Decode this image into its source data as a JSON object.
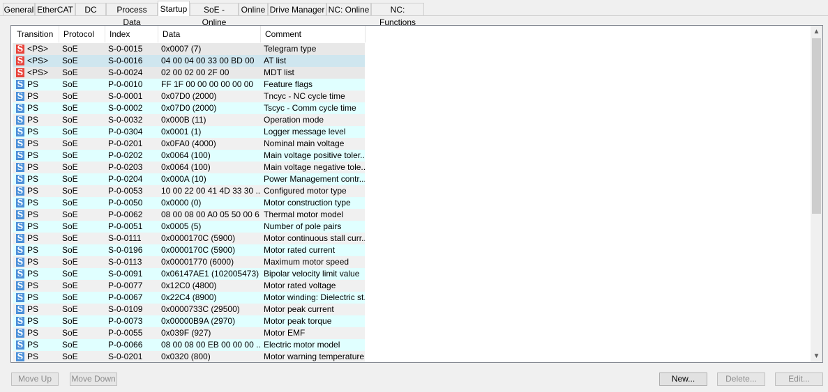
{
  "tabs": [
    "General",
    "EtherCAT",
    "DC",
    "Process Data",
    "Startup",
    "SoE - Online",
    "Online",
    "Drive Manager",
    "NC: Online",
    "NC: Functions"
  ],
  "active_tab": "Startup",
  "columns": [
    "Transition",
    "Protocol",
    "Index",
    "Data",
    "Comment"
  ],
  "icon_letter": "S",
  "rows": [
    {
      "transition": "<PS>",
      "protocol": "SoE",
      "index": "S-0-0015",
      "data": "0x0007 (7)",
      "comment": "Telegram type"
    },
    {
      "transition": "<PS>",
      "protocol": "SoE",
      "index": "S-0-0016",
      "data": "04 00 04 00 33 00 BD 00",
      "comment": "AT list"
    },
    {
      "transition": "<PS>",
      "protocol": "SoE",
      "index": "S-0-0024",
      "data": "02 00 02 00 2F 00",
      "comment": "MDT list"
    },
    {
      "transition": "PS",
      "protocol": "SoE",
      "index": "P-0-0010",
      "data": "FF 1F 00 00 00 00 00 00",
      "comment": "Feature flags"
    },
    {
      "transition": "PS",
      "protocol": "SoE",
      "index": "S-0-0001",
      "data": "0x07D0 (2000)",
      "comment": "Tncyc - NC cycle time"
    },
    {
      "transition": "PS",
      "protocol": "SoE",
      "index": "S-0-0002",
      "data": "0x07D0 (2000)",
      "comment": "Tscyc - Comm cycle time"
    },
    {
      "transition": "PS",
      "protocol": "SoE",
      "index": "S-0-0032",
      "data": "0x000B (11)",
      "comment": "Operation mode"
    },
    {
      "transition": "PS",
      "protocol": "SoE",
      "index": "P-0-0304",
      "data": "0x0001 (1)",
      "comment": "Logger message level"
    },
    {
      "transition": "PS",
      "protocol": "SoE",
      "index": "P-0-0201",
      "data": "0x0FA0 (4000)",
      "comment": "Nominal main voltage"
    },
    {
      "transition": "PS",
      "protocol": "SoE",
      "index": "P-0-0202",
      "data": "0x0064 (100)",
      "comment": "Main voltage positive toler..."
    },
    {
      "transition": "PS",
      "protocol": "SoE",
      "index": "P-0-0203",
      "data": "0x0064 (100)",
      "comment": "Main voltage negative tole..."
    },
    {
      "transition": "PS",
      "protocol": "SoE",
      "index": "P-0-0204",
      "data": "0x000A (10)",
      "comment": "Power Management contr..."
    },
    {
      "transition": "PS",
      "protocol": "SoE",
      "index": "P-0-0053",
      "data": "10 00 22 00 41 4D 33 30 ...",
      "comment": "Configured motor type"
    },
    {
      "transition": "PS",
      "protocol": "SoE",
      "index": "P-0-0050",
      "data": "0x0000 (0)",
      "comment": "Motor construction type"
    },
    {
      "transition": "PS",
      "protocol": "SoE",
      "index": "P-0-0062",
      "data": "08 00 08 00 A0 05 50 00 6...",
      "comment": "Thermal motor model"
    },
    {
      "transition": "PS",
      "protocol": "SoE",
      "index": "P-0-0051",
      "data": "0x0005 (5)",
      "comment": "Number of pole pairs"
    },
    {
      "transition": "PS",
      "protocol": "SoE",
      "index": "S-0-0111",
      "data": "0x0000170C (5900)",
      "comment": "Motor continuous stall curr..."
    },
    {
      "transition": "PS",
      "protocol": "SoE",
      "index": "S-0-0196",
      "data": "0x0000170C (5900)",
      "comment": "Motor rated current"
    },
    {
      "transition": "PS",
      "protocol": "SoE",
      "index": "S-0-0113",
      "data": "0x00001770 (6000)",
      "comment": "Maximum motor speed"
    },
    {
      "transition": "PS",
      "protocol": "SoE",
      "index": "S-0-0091",
      "data": "0x06147AE1 (102005473)",
      "comment": "Bipolar velocity limit value"
    },
    {
      "transition": "PS",
      "protocol": "SoE",
      "index": "P-0-0077",
      "data": "0x12C0 (4800)",
      "comment": "Motor rated voltage"
    },
    {
      "transition": "PS",
      "protocol": "SoE",
      "index": "P-0-0067",
      "data": "0x22C4 (8900)",
      "comment": "Motor winding: Dielectric st..."
    },
    {
      "transition": "PS",
      "protocol": "SoE",
      "index": "S-0-0109",
      "data": "0x0000733C (29500)",
      "comment": "Motor peak current"
    },
    {
      "transition": "PS",
      "protocol": "SoE",
      "index": "P-0-0073",
      "data": "0x00000B9A (2970)",
      "comment": "Motor peak torque"
    },
    {
      "transition": "PS",
      "protocol": "SoE",
      "index": "P-0-0055",
      "data": "0x039F (927)",
      "comment": "Motor EMF"
    },
    {
      "transition": "PS",
      "protocol": "SoE",
      "index": "P-0-0066",
      "data": "08 00 08 00 EB 00 00 00 ...",
      "comment": "Electric motor model"
    },
    {
      "transition": "PS",
      "protocol": "SoE",
      "index": "S-0-0201",
      "data": "0x0320 (800)",
      "comment": "Motor warning temperature"
    }
  ],
  "buttons": {
    "move_up": "Move Up",
    "move_down": "Move Down",
    "new": "New...",
    "delete": "Delete...",
    "edit": "Edit..."
  },
  "colors": {
    "icon_red": "#e8423a",
    "icon_blue": "#4a8fd8",
    "row_cyan": "#e0ffff",
    "row_selected": "#cfe6ef"
  }
}
